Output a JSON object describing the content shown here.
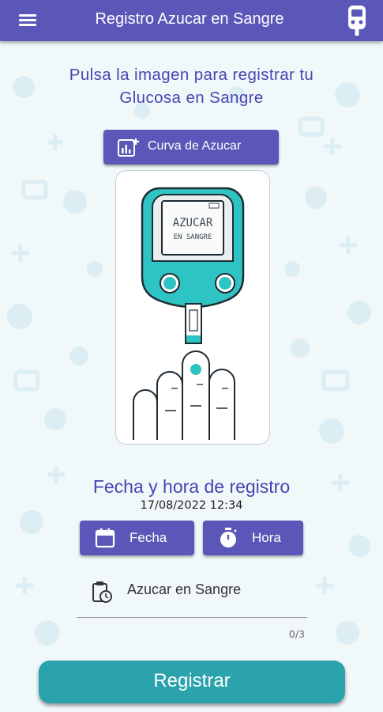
{
  "appbar": {
    "title": "Registro Azucar en Sangre",
    "menu_icon": "menu-icon",
    "action_icon": "glucometer-icon",
    "color": "#5b57b8"
  },
  "prompt": {
    "line1": "Pulsa la imagen para registrar tu",
    "line2": "Glucosa en Sangre"
  },
  "curve_button": {
    "label": "Curva de Azucar",
    "icon": "chart-add-icon"
  },
  "illustration": {
    "screen_line1": "AZUCAR",
    "screen_line2": "EN SANGRE",
    "accent": "#2fc4c4"
  },
  "datetime": {
    "title": "Fecha y hora de registro",
    "value": "17/08/2022 12:34"
  },
  "date_button": {
    "label": "Fecha",
    "icon": "calendar-icon"
  },
  "time_button": {
    "label": "Hora",
    "icon": "stopwatch-icon"
  },
  "glucose_input": {
    "label": "Azucar en Sangre",
    "icon": "clipboard-clock-icon",
    "counter": "0/3"
  },
  "register_button": {
    "label": "Registrar",
    "color": "#2aa3ac"
  }
}
